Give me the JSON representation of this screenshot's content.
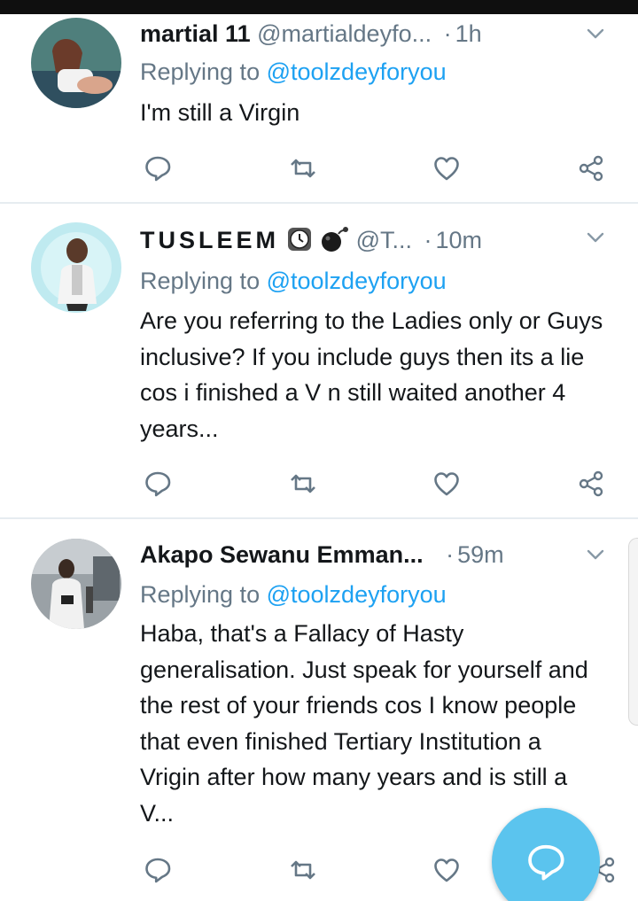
{
  "colors": {
    "accent": "#1da1f2",
    "fab": "#5bc4ee",
    "text_primary": "#14171a",
    "text_secondary": "#657786"
  },
  "tweets": [
    {
      "display_name": "martial 11",
      "handle": "@martialdeyfo...",
      "separator": "·",
      "time": "1h",
      "reply_prefix": "Replying to",
      "reply_to": "@toolzdeyforyou",
      "text": "I'm still a Virgin",
      "icons": [
        "reply-icon",
        "retweet-icon",
        "like-icon",
        "share-icon"
      ]
    },
    {
      "display_name": "TUSLEEM",
      "name_emoji": [
        "clock-emoji",
        "bomb-emoji"
      ],
      "handle": "@T...",
      "separator": "·",
      "time": "10m",
      "reply_prefix": "Replying to",
      "reply_to": "@toolzdeyforyou",
      "text": "Are you referring to the Ladies only or Guys inclusive? If you include guys then its a lie cos i finished a V n still waited another 4 years...",
      "icons": [
        "reply-icon",
        "retweet-icon",
        "like-icon",
        "share-icon"
      ]
    },
    {
      "display_name": "Akapo Sewanu Emman...",
      "separator": "·",
      "time": "59m",
      "reply_prefix": "Replying to",
      "reply_to": "@toolzdeyforyou",
      "text": "Haba, that's a Fallacy of Hasty generalisation. Just speak for yourself and the rest of your friends cos I know people that even finished Tertiary Institution a Vrigin after how many years and is still a V...",
      "icons": [
        "reply-icon",
        "retweet-icon",
        "like-icon",
        "share-icon"
      ]
    }
  ],
  "fab": {
    "icon": "compose-reply-icon"
  }
}
